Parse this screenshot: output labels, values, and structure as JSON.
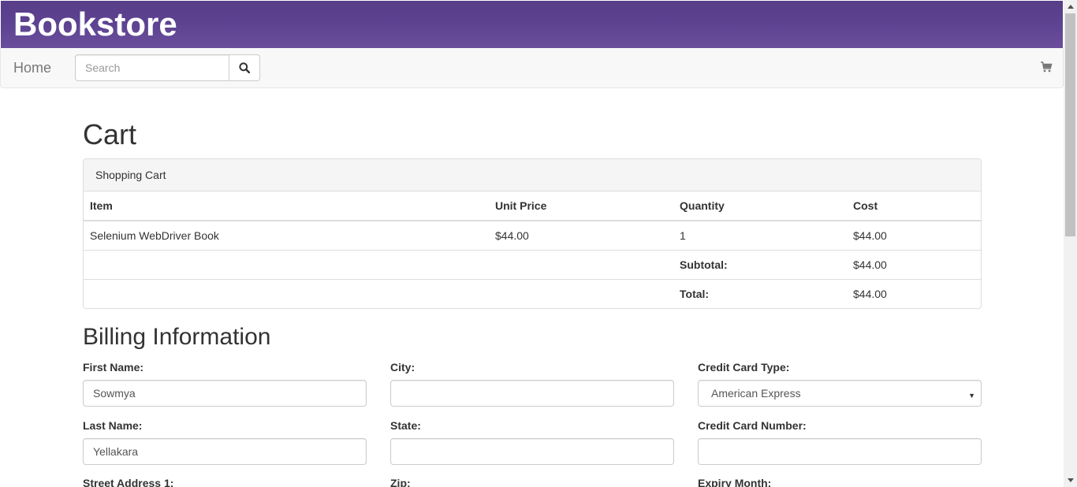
{
  "header": {
    "title": "Bookstore"
  },
  "navbar": {
    "home_label": "Home",
    "search_placeholder": "Search",
    "search_icon": "search-icon",
    "cart_icon": "shopping-cart-icon"
  },
  "page": {
    "title": "Cart"
  },
  "cart": {
    "panel_heading": "Shopping Cart",
    "columns": [
      "Item",
      "Unit Price",
      "Quantity",
      "Cost"
    ],
    "rows": [
      {
        "item": "Selenium WebDriver Book",
        "unit_price": "$44.00",
        "quantity": "1",
        "cost": "$44.00"
      }
    ],
    "subtotal_label": "Subtotal:",
    "subtotal_value": "$44.00",
    "total_label": "Total:",
    "total_value": "$44.00"
  },
  "billing": {
    "title": "Billing Information",
    "first_name_label": "First Name:",
    "first_name_value": "Sowmya",
    "last_name_label": "Last Name:",
    "last_name_value": "Yellakara",
    "street1_label": "Street Address 1:",
    "city_label": "City:",
    "city_value": "",
    "state_label": "State:",
    "state_value": "",
    "zip_label": "Zip:",
    "card_type_label": "Credit Card Type:",
    "card_type_value": "American Express",
    "card_number_label": "Credit Card Number:",
    "card_number_value": "",
    "expiry_month_label": "Expiry Month:"
  },
  "colors": {
    "banner": "#5c4290",
    "navbar_bg": "#f8f8f8",
    "border": "#dddddd"
  }
}
